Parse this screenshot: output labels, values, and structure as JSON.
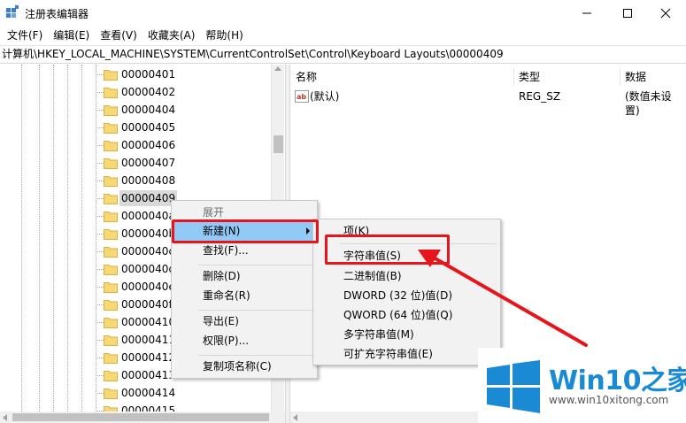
{
  "window": {
    "title": "注册表编辑器",
    "controls": {
      "minimize": "—",
      "maximize": "☐",
      "close": "✕"
    }
  },
  "menubar": [
    "文件(F)",
    "编辑(E)",
    "查看(V)",
    "收藏夹(A)",
    "帮助(H)"
  ],
  "address": "计算机\\HKEY_LOCAL_MACHINE\\SYSTEM\\CurrentControlSet\\Control\\Keyboard Layouts\\00000409",
  "tree": {
    "items": [
      "00000401",
      "00000402",
      "00000404",
      "00000405",
      "00000406",
      "00000407",
      "00000408",
      "00000409",
      "0000040a",
      "0000040b",
      "0000040c",
      "0000040d",
      "0000040e",
      "0000040f",
      "00000410",
      "00000411",
      "00000412",
      "00000413",
      "00000414",
      "00000415"
    ],
    "selected": "00000409"
  },
  "values": {
    "headers": {
      "name": "名称",
      "type": "类型",
      "data": "数据"
    },
    "rows": [
      {
        "name": "(默认)",
        "type": "REG_SZ",
        "data": "(数值未设置)"
      }
    ]
  },
  "context_menu": {
    "items": {
      "expand": "展开",
      "new": "新建(N)",
      "find": "查找(F)...",
      "delete": "删除(D)",
      "rename": "重命名(R)",
      "export": "导出(E)",
      "permissions": "权限(P)...",
      "copy_key_name": "复制项名称(C)"
    }
  },
  "submenu": {
    "items": {
      "key": "项(K)",
      "string": "字符串值(S)",
      "binary": "二进制值(B)",
      "dword": "DWORD (32 位)值(D)",
      "qword": "QWORD (64 位)值(Q)",
      "multi_string": "多字符串值(M)",
      "expandable_string": "可扩充字符串值(E)"
    }
  },
  "watermark": {
    "brand_win10": "Win10",
    "brand_zhijia": "之家",
    "url": "www.win10xitong.com"
  },
  "colors": {
    "highlight": "#91c9f7",
    "annotation_red": "#e8141b",
    "folder": "#f8d775",
    "brand_blue": "#1a8ad4"
  }
}
